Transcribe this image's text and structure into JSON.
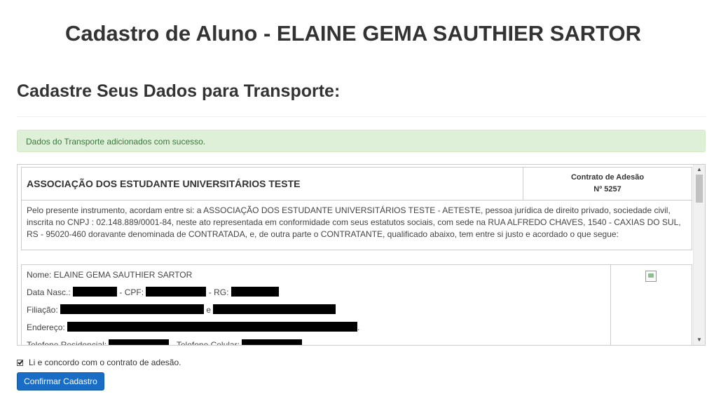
{
  "page": {
    "title": "Cadastro de Aluno - ELAINE GEMA SAUTHIER SARTOR",
    "section_title": "Cadastre Seus Dados para Transporte:"
  },
  "alert": {
    "message": "Dados do Transporte adicionados com sucesso."
  },
  "contract": {
    "association_name": "ASSOCIAÇÃO DOS ESTUDANTE UNIVERSITÁRIOS TESTE",
    "contract_type": "Contrato de Adesão",
    "contract_number": "Nº 5257",
    "body_text": "Pelo presente instrumento, acordam entre si: a ASSOCIAÇÃO DOS ESTUDANTE UNIVERSITÁRIOS TESTE - AETESTE, pessoa jurídica de direito privado, sociedade civil, inscrita no CNPJ : 02.148.889/0001-84, neste ato representada em conformidade com seus estatutos sociais, com sede na RUA ALFREDO CHAVES, 1540 - CAXIAS DO SUL, RS - 95020-460 doravante denominada de CONTRATADA, e, de outra parte o CONTRATANTE, qualificado abaixo, tem entre si justo e acordado o que segue:",
    "student": {
      "name_line": "Nome: ELAINE GEMA SAUTHIER SARTOR",
      "birth_label": "Data Nasc.:",
      "cpf_label": "- CPF:",
      "rg_label": "- RG:",
      "filiation_label": "Filiação:",
      "filiation_sep": "e",
      "address_label": "Endereço:",
      "address_end": ".",
      "phone_label": "Telefone Residencial:",
      "cell_label": "- Telefone Celular:"
    }
  },
  "agreement": {
    "label": "Li e concordo com o contrato de adesão.",
    "checked": true
  },
  "confirm_button": {
    "label": "Confirmar Cadastro"
  },
  "icons": {
    "photo": "broken-image-icon",
    "check": "check-icon"
  },
  "colors": {
    "alert_bg": "#dff0d8",
    "alert_text": "#3c763d",
    "button_bg": "#1a6dc4"
  }
}
